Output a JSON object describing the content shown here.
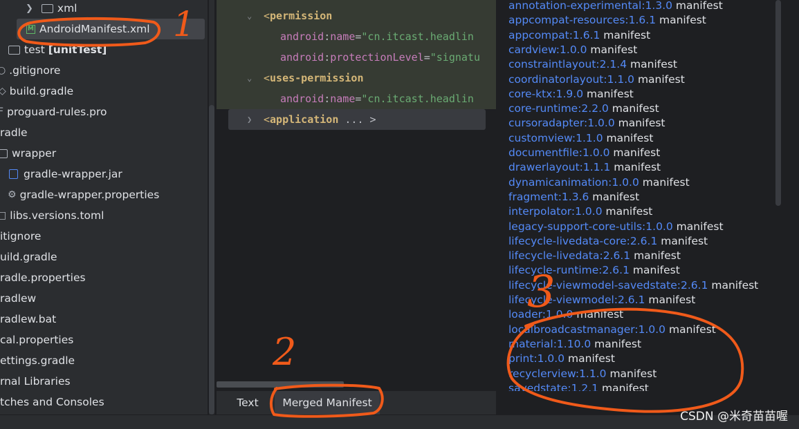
{
  "tree": {
    "rows": [
      {
        "label": "xml",
        "type": "folder"
      },
      {
        "label": "AndroidManifest.xml",
        "type": "manifest"
      },
      {
        "label": "test",
        "suffix": "[unitTest]",
        "type": "folder"
      },
      {
        "label": ".gitignore",
        "type": "file"
      },
      {
        "label": "build.gradle",
        "type": "gradle"
      },
      {
        "label": "proguard-rules.pro",
        "type": "file"
      },
      {
        "label": "radle",
        "type": "folder"
      },
      {
        "label": "wrapper",
        "type": "folder"
      },
      {
        "label": "gradle-wrapper.jar",
        "type": "jar"
      },
      {
        "label": "gradle-wrapper.properties",
        "type": "gear"
      },
      {
        "label": "libs.versions.toml",
        "type": "file"
      },
      {
        "label": "itignore",
        "type": "file"
      },
      {
        "label": "uild.gradle",
        "type": "file"
      },
      {
        "label": "radle.properties",
        "type": "file"
      },
      {
        "label": "radlew",
        "type": "file"
      },
      {
        "label": "radlew.bat",
        "type": "file"
      },
      {
        "label": "cal.properties",
        "type": "file"
      },
      {
        "label": "ettings.gradle",
        "type": "file"
      },
      {
        "label": "rnal Libraries",
        "type": "file"
      },
      {
        "label": "tches and Consoles",
        "type": "file"
      }
    ]
  },
  "editor": {
    "line1": {
      "lt": "<",
      "tag": "permission"
    },
    "line2": {
      "ns": "android",
      "colon": ":",
      "attr": "name",
      "eq": "=",
      "value": "\"cn.itcast.headlin"
    },
    "line3": {
      "ns": "android",
      "colon": ":",
      "attr": "protectionLevel",
      "eq": "=",
      "value": "\"signatu"
    },
    "line4": {
      "lt": "<",
      "tag": "uses-permission"
    },
    "line5": {
      "ns": "android",
      "colon": ":",
      "attr": "name",
      "eq": "=",
      "value": "\"cn.itcast.headlin"
    },
    "line6": {
      "lt": "<",
      "tag": "application",
      "rest": " ... >"
    }
  },
  "tabs": {
    "text": "Text",
    "merged": "Merged Manifest"
  },
  "sources": [
    {
      "lib": "annotation-experimental:1.3.0",
      "suffix": " manifest"
    },
    {
      "lib": "appcompat-resources:1.6.1",
      "suffix": " manifest"
    },
    {
      "lib": "appcompat:1.6.1",
      "suffix": " manifest"
    },
    {
      "lib": "cardview:1.0.0",
      "suffix": " manifest"
    },
    {
      "lib": "constraintlayout:2.1.4",
      "suffix": " manifest"
    },
    {
      "lib": "coordinatorlayout:1.1.0",
      "suffix": " manifest"
    },
    {
      "lib": "core-ktx:1.9.0",
      "suffix": " manifest"
    },
    {
      "lib": "core-runtime:2.2.0",
      "suffix": " manifest"
    },
    {
      "lib": "cursoradapter:1.0.0",
      "suffix": " manifest"
    },
    {
      "lib": "customview:1.1.0",
      "suffix": " manifest"
    },
    {
      "lib": "documentfile:1.0.0",
      "suffix": " manifest"
    },
    {
      "lib": "drawerlayout:1.1.1",
      "suffix": " manifest"
    },
    {
      "lib": "dynamicanimation:1.0.0",
      "suffix": " manifest"
    },
    {
      "lib": "fragment:1.3.6",
      "suffix": " manifest"
    },
    {
      "lib": "interpolator:1.0.0",
      "suffix": " manifest"
    },
    {
      "lib": "legacy-support-core-utils:1.0.0",
      "suffix": " manifest"
    },
    {
      "lib": "lifecycle-livedata-core:2.6.1",
      "suffix": " manifest"
    },
    {
      "lib": "lifecycle-livedata:2.6.1",
      "suffix": " manifest"
    },
    {
      "lib": "lifecycle-runtime:2.6.1",
      "suffix": " manifest"
    },
    {
      "lib": "lifecycle-viewmodel-savedstate:2.6.1",
      "suffix": " manifest"
    },
    {
      "lib": "lifecycle-viewmodel:2.6.1",
      "suffix": " manifest"
    },
    {
      "lib": "loader:1.0.0",
      "suffix": " manifest"
    },
    {
      "lib": "localbroadcastmanager:1.0.0",
      "suffix": " manifest"
    },
    {
      "lib": "material:1.10.0",
      "suffix": " manifest"
    },
    {
      "lib": "print:1.0.0",
      "suffix": " manifest"
    },
    {
      "lib": "recyclerview:1.1.0",
      "suffix": " manifest"
    },
    {
      "lib": "savedstate:1.2.1",
      "suffix": " manifest"
    }
  ],
  "annotations": {
    "n1": "1",
    "n2": "2",
    "n3": "3",
    "color": "#f05a1a"
  },
  "watermark": "CSDN @米奇苗苗喔"
}
